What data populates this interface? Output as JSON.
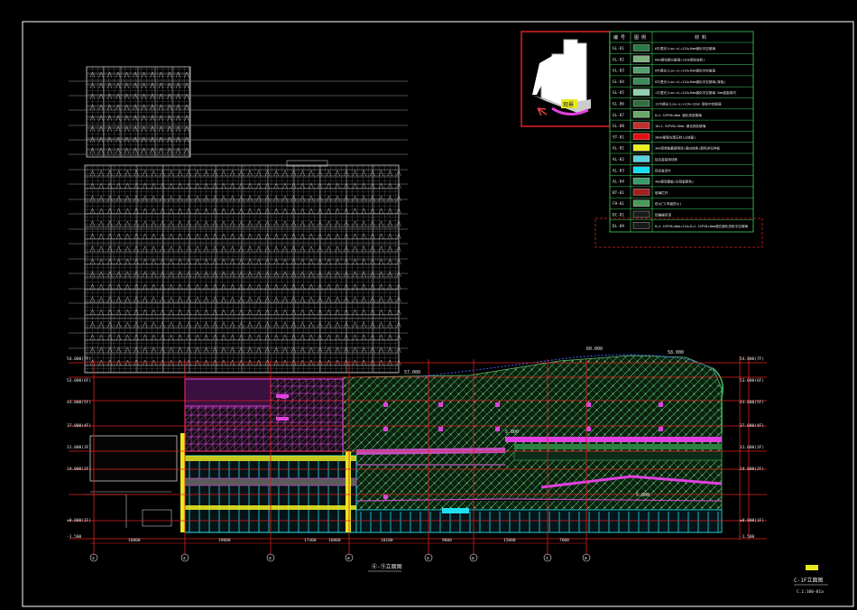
{
  "legend": {
    "header": {
      "code": "编 号",
      "sample": "图 例",
      "desc": "材 料"
    },
    "rows": [
      {
        "code": "GL-01",
        "swatch": "#2a7a45",
        "desc": "6中透光(Low-e)+12A+6mm钢化中空玻璃"
      },
      {
        "code": "GL-02",
        "swatch": "#7fb07f",
        "desc": "6mm钢化超白玻璃(12mm钢化夹胶)"
      },
      {
        "code": "GL-03",
        "swatch": "#55a070",
        "desc": "6中透光(Low-e)+12A+6mm钢化中空玻璃"
      },
      {
        "code": "GL-04",
        "swatch": "#3c8c5a",
        "desc": "6中透光(Low-e)+12A+6mm钢化中空玻璃(背板)"
      },
      {
        "code": "GL-05",
        "swatch": "#8fd0b0",
        "desc": "(中透光)Low-e)+12A+6mm钢化中空玻璃 5mm铝板背衬"
      },
      {
        "code": "GL-06",
        "swatch": "#2f6f3f",
        "desc": "12中透光(Low-e)+12A+12mm 钢化中空玻璃"
      },
      {
        "code": "GL-07",
        "swatch": "#6aa86a",
        "desc": "8+1.52PVB+8mm 钢化夹胶玻璃"
      },
      {
        "code": "GL-08",
        "swatch": "#c0302f",
        "desc": "10+1.52PVB+10mm 钢化夹胶玻璃"
      },
      {
        "code": "ST-01",
        "swatch": "#e01010",
        "desc": "30mm厚蒙古黑石材(火烧面)"
      },
      {
        "code": "AL-01",
        "swatch": "#e8f020",
        "desc": "3mm铝单板氟碳喷涂(竖向线条)颜色详见样板"
      },
      {
        "code": "AL-02",
        "swatch": "#5ad0e0",
        "desc": "铝合金装饰线条"
      },
      {
        "code": "AL-03",
        "swatch": "#10e0f0",
        "desc": "铝合金百叶"
      },
      {
        "code": "AL-04",
        "swatch": "#3a9a6a",
        "desc": "4mm厚铝塑板(仿铝板颜色)"
      },
      {
        "code": "BT-01",
        "swatch": "#a02020",
        "desc": "玻璃栏杆"
      },
      {
        "code": "FH-01",
        "swatch": "#4a9a5a",
        "desc": "防火门(甲级防火)"
      },
      {
        "code": "DC-01",
        "swatch": "#1a1a1a",
        "desc": "铝格栅吊顶"
      },
      {
        "code": "DL-09",
        "swatch": "#1a1a1a",
        "desc": "8+1.52PVB+8mm+12A+8+1.52PVB+8mm超白钢化夹胶中空玻璃"
      }
    ]
  },
  "keyplan": {
    "label": "观景"
  },
  "elevation_levels_left": [
    "54.000(7F)",
    "53.000(6F)",
    "43.000(5F)",
    "37.000(4F)",
    "31.000(3F)",
    "24.000(2F)",
    "±0.000(1F)",
    "-1.500"
  ],
  "elevation_levels_right": [
    "54.000(7F)",
    "53.000(6F)",
    "43.000(5F)",
    "37.000(4F)",
    "31.000(3F)",
    "24.000(2F)",
    "±0.000(1F)",
    "-1.500"
  ],
  "top_dims": {
    "a": "57.000",
    "b": "58.000",
    "c": "60.000"
  },
  "inner_dims": [
    "5.800",
    "5.800"
  ],
  "bay_dims": [
    "16800",
    "19800",
    "17400",
    "16800",
    "10100",
    "9600",
    "15000",
    "7600"
  ],
  "grid_axes": [
    "①",
    "②",
    "③",
    "④",
    "⑤",
    "⑥",
    "⑦",
    "⑧",
    "⑨"
  ],
  "drawing_title": "⑥-⑨立面图",
  "sheet": {
    "code": "C-1F",
    "title": "C-1F立面图",
    "scale": "C.1:100-01a"
  },
  "colors": {
    "frame": "#ffffff",
    "grid": "#e02020",
    "tower": "#bfbfbf",
    "magenta": "#e040e0",
    "green": "#40c060",
    "cyan": "#20e0f0",
    "yellow": "#e8e820"
  }
}
